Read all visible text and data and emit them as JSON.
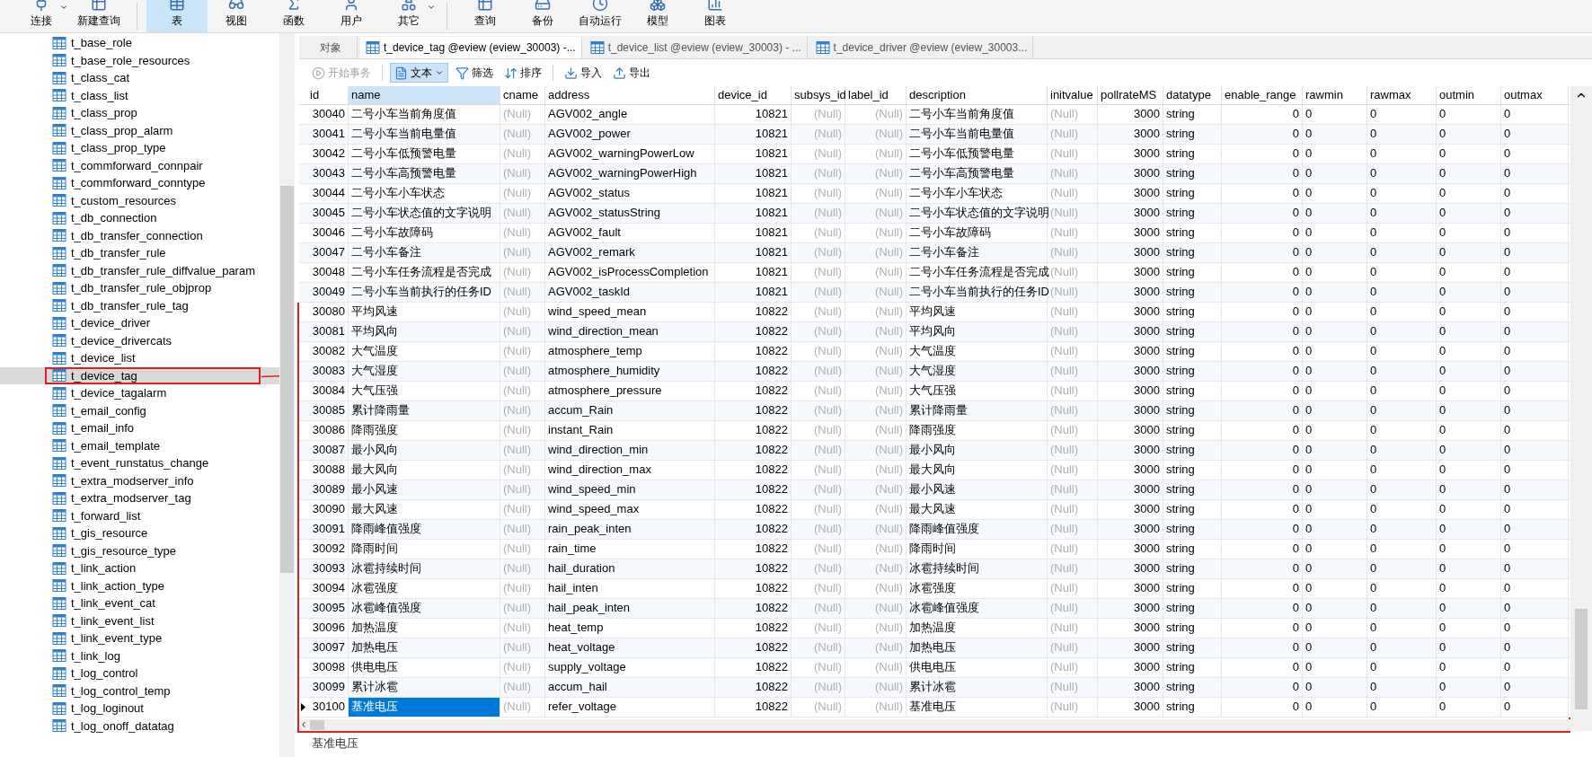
{
  "toolbar": {
    "buttons": [
      {
        "label": "连接",
        "kind": "connect",
        "selected": false,
        "menu": true
      },
      {
        "label": "新建查询",
        "kind": "new_query",
        "selected": false,
        "menu": false
      },
      {
        "label": "表",
        "kind": "table",
        "selected": true,
        "menu": false
      },
      {
        "label": "视图",
        "kind": "view",
        "selected": false,
        "menu": false
      },
      {
        "label": "函数",
        "kind": "function",
        "selected": false,
        "menu": false
      },
      {
        "label": "用户",
        "kind": "user",
        "selected": false,
        "menu": false
      },
      {
        "label": "其它",
        "kind": "other",
        "selected": false,
        "menu": true
      },
      {
        "label": "查询",
        "kind": "query",
        "selected": false,
        "menu": false
      },
      {
        "label": "备份",
        "kind": "backup",
        "selected": false,
        "menu": false
      },
      {
        "label": "自动运行",
        "kind": "schedule",
        "selected": false,
        "menu": false
      },
      {
        "label": "模型",
        "kind": "model",
        "selected": false,
        "menu": false
      },
      {
        "label": "图表",
        "kind": "chart",
        "selected": false,
        "menu": false
      }
    ]
  },
  "sidebar": {
    "items": [
      {
        "label": "t_base_role",
        "selected": false,
        "highlighted": false
      },
      {
        "label": "t_base_role_resources",
        "selected": false,
        "highlighted": false
      },
      {
        "label": "t_class_cat",
        "selected": false,
        "highlighted": false
      },
      {
        "label": "t_class_list",
        "selected": false,
        "highlighted": false
      },
      {
        "label": "t_class_prop",
        "selected": false,
        "highlighted": false
      },
      {
        "label": "t_class_prop_alarm",
        "selected": false,
        "highlighted": false
      },
      {
        "label": "t_class_prop_type",
        "selected": false,
        "highlighted": false
      },
      {
        "label": "t_commforward_connpair",
        "selected": false,
        "highlighted": false
      },
      {
        "label": "t_commforward_conntype",
        "selected": false,
        "highlighted": false
      },
      {
        "label": "t_custom_resources",
        "selected": false,
        "highlighted": false
      },
      {
        "label": "t_db_connection",
        "selected": false,
        "highlighted": false
      },
      {
        "label": "t_db_transfer_connection",
        "selected": false,
        "highlighted": false
      },
      {
        "label": "t_db_transfer_rule",
        "selected": false,
        "highlighted": false
      },
      {
        "label": "t_db_transfer_rule_diffvalue_param",
        "selected": false,
        "highlighted": false
      },
      {
        "label": "t_db_transfer_rule_objprop",
        "selected": false,
        "highlighted": false
      },
      {
        "label": "t_db_transfer_rule_tag",
        "selected": false,
        "highlighted": false
      },
      {
        "label": "t_device_driver",
        "selected": false,
        "highlighted": false
      },
      {
        "label": "t_device_drivercats",
        "selected": false,
        "highlighted": false
      },
      {
        "label": "t_device_list",
        "selected": false,
        "highlighted": false
      },
      {
        "label": "t_device_tag",
        "selected": true,
        "highlighted": true
      },
      {
        "label": "t_device_tagalarm",
        "selected": false,
        "highlighted": false
      },
      {
        "label": "t_email_config",
        "selected": false,
        "highlighted": false
      },
      {
        "label": "t_email_info",
        "selected": false,
        "highlighted": false
      },
      {
        "label": "t_email_template",
        "selected": false,
        "highlighted": false
      },
      {
        "label": "t_event_runstatus_change",
        "selected": false,
        "highlighted": false
      },
      {
        "label": "t_extra_modserver_info",
        "selected": false,
        "highlighted": false
      },
      {
        "label": "t_extra_modserver_tag",
        "selected": false,
        "highlighted": false
      },
      {
        "label": "t_forward_list",
        "selected": false,
        "highlighted": false
      },
      {
        "label": "t_gis_resource",
        "selected": false,
        "highlighted": false
      },
      {
        "label": "t_gis_resource_type",
        "selected": false,
        "highlighted": false
      },
      {
        "label": "t_link_action",
        "selected": false,
        "highlighted": false
      },
      {
        "label": "t_link_action_type",
        "selected": false,
        "highlighted": false
      },
      {
        "label": "t_link_event_cat",
        "selected": false,
        "highlighted": false
      },
      {
        "label": "t_link_event_list",
        "selected": false,
        "highlighted": false
      },
      {
        "label": "t_link_event_type",
        "selected": false,
        "highlighted": false
      },
      {
        "label": "t_link_log",
        "selected": false,
        "highlighted": false
      },
      {
        "label": "t_log_control",
        "selected": false,
        "highlighted": false
      },
      {
        "label": "t_log_control_temp",
        "selected": false,
        "highlighted": false
      },
      {
        "label": "t_log_loginout",
        "selected": false,
        "highlighted": false
      },
      {
        "label": "t_log_onoff_datatag",
        "selected": false,
        "highlighted": false
      }
    ]
  },
  "tabs": [
    {
      "label": "对象",
      "kind": "objects",
      "selected": false
    },
    {
      "label": "t_device_tag @eview (eview_30003) -...",
      "kind": "table",
      "selected": true
    },
    {
      "label": "t_device_list @eview (eview_30003) - ...",
      "kind": "table",
      "selected": false
    },
    {
      "label": "t_device_driver @eview (eview_30003...",
      "kind": "table",
      "selected": false
    }
  ],
  "grid_toolbar": {
    "buttons": [
      {
        "label": "开始事务",
        "kind": "transaction",
        "disabled": true,
        "pressed": false,
        "menu": false
      },
      {
        "label": "文本",
        "kind": "text",
        "disabled": false,
        "pressed": true,
        "menu": true
      },
      {
        "label": "筛选",
        "kind": "filter",
        "disabled": false,
        "pressed": false,
        "menu": false
      },
      {
        "label": "排序",
        "kind": "sort",
        "disabled": false,
        "pressed": false,
        "menu": false
      },
      {
        "label": "导入",
        "kind": "import",
        "disabled": false,
        "pressed": false,
        "menu": false
      },
      {
        "label": "导出",
        "kind": "export",
        "disabled": false,
        "pressed": false,
        "menu": false
      }
    ]
  },
  "table": {
    "columns": [
      {
        "label": "id",
        "kind": "number",
        "empty": false,
        "focused": false
      },
      {
        "label": "name",
        "kind": "text",
        "empty": false,
        "focused": true
      },
      {
        "label": "cname",
        "kind": "text",
        "empty": true,
        "focused": false
      },
      {
        "label": "address",
        "kind": "text",
        "empty": false,
        "focused": false
      },
      {
        "label": "device_id",
        "kind": "number",
        "empty": false,
        "focused": false
      },
      {
        "label": "subsys_id",
        "kind": "number",
        "empty": true,
        "focused": false
      },
      {
        "label": "label_id",
        "kind": "number",
        "empty": true,
        "focused": false
      },
      {
        "label": "description",
        "kind": "text",
        "empty": false,
        "focused": false
      },
      {
        "label": "initvalue",
        "kind": "text",
        "empty": true,
        "focused": false
      },
      {
        "label": "pollrateMS",
        "kind": "number",
        "empty": false,
        "focused": false
      },
      {
        "label": "datatype",
        "kind": "text",
        "empty": false,
        "focused": false
      },
      {
        "label": "enable_range",
        "kind": "number",
        "empty": false,
        "focused": false
      },
      {
        "label": "rawmin",
        "kind": "text",
        "empty": false,
        "focused": false
      },
      {
        "label": "rawmax",
        "kind": "text",
        "empty": false,
        "focused": false
      },
      {
        "label": "outmin",
        "kind": "text",
        "empty": false,
        "focused": false
      },
      {
        "label": "outmax",
        "kind": "text",
        "empty": false,
        "focused": false
      }
    ],
    "row_groups": [
      {
        "annotated": false,
        "rows": [
          {
            "selected": false,
            "cells": [
              "30040",
              "二号小车当前角度值",
              "(Null)",
              "AGV002_angle",
              "10821",
              "(Null)",
              "(Null)",
              "二号小车当前角度值",
              "(Null)",
              "3000",
              "string",
              "0",
              "0",
              "0",
              "0",
              "0"
            ]
          },
          {
            "selected": false,
            "cells": [
              "30041",
              "二号小车当前电量值",
              "(Null)",
              "AGV002_power",
              "10821",
              "(Null)",
              "(Null)",
              "二号小车当前电量值",
              "(Null)",
              "3000",
              "string",
              "0",
              "0",
              "0",
              "0",
              "0"
            ]
          },
          {
            "selected": false,
            "cells": [
              "30042",
              "二号小车低预警电量",
              "(Null)",
              "AGV002_warningPowerLow",
              "10821",
              "(Null)",
              "(Null)",
              "二号小车低预警电量",
              "(Null)",
              "3000",
              "string",
              "0",
              "0",
              "0",
              "0",
              "0"
            ]
          },
          {
            "selected": false,
            "cells": [
              "30043",
              "二号小车高预警电量",
              "(Null)",
              "AGV002_warningPowerHigh",
              "10821",
              "(Null)",
              "(Null)",
              "二号小车高预警电量",
              "(Null)",
              "3000",
              "string",
              "0",
              "0",
              "0",
              "0",
              "0"
            ]
          },
          {
            "selected": false,
            "cells": [
              "30044",
              "二号小车小车状态",
              "(Null)",
              "AGV002_status",
              "10821",
              "(Null)",
              "(Null)",
              "二号小车小车状态",
              "(Null)",
              "3000",
              "string",
              "0",
              "0",
              "0",
              "0",
              "0"
            ]
          },
          {
            "selected": false,
            "cells": [
              "30045",
              "二号小车状态值的文字说明",
              "(Null)",
              "AGV002_statusString",
              "10821",
              "(Null)",
              "(Null)",
              "二号小车状态值的文字说明",
              "(Null)",
              "3000",
              "string",
              "0",
              "0",
              "0",
              "0",
              "0"
            ]
          },
          {
            "selected": false,
            "cells": [
              "30046",
              "二号小车故障码",
              "(Null)",
              "AGV002_fault",
              "10821",
              "(Null)",
              "(Null)",
              "二号小车故障码",
              "(Null)",
              "3000",
              "string",
              "0",
              "0",
              "0",
              "0",
              "0"
            ]
          },
          {
            "selected": false,
            "cells": [
              "30047",
              "二号小车备注",
              "(Null)",
              "AGV002_remark",
              "10821",
              "(Null)",
              "(Null)",
              "二号小车备注",
              "(Null)",
              "3000",
              "string",
              "0",
              "0",
              "0",
              "0",
              "0"
            ]
          },
          {
            "selected": false,
            "cells": [
              "30048",
              "二号小车任务流程是否完成",
              "(Null)",
              "AGV002_isProcessCompletion",
              "10821",
              "(Null)",
              "(Null)",
              "二号小车任务流程是否完成",
              "(Null)",
              "3000",
              "string",
              "0",
              "0",
              "0",
              "0",
              "0"
            ]
          },
          {
            "selected": false,
            "cells": [
              "30049",
              "二号小车当前执行的任务ID",
              "(Null)",
              "AGV002_taskId",
              "10821",
              "(Null)",
              "(Null)",
              "二号小车当前执行的任务ID",
              "(Null)",
              "3000",
              "string",
              "0",
              "0",
              "0",
              "0",
              "0"
            ]
          }
        ]
      },
      {
        "annotated": true,
        "rows": [
          {
            "selected": false,
            "cells": [
              "30080",
              "平均风速",
              "(Null)",
              "wind_speed_mean",
              "10822",
              "(Null)",
              "(Null)",
              "平均风速",
              "(Null)",
              "3000",
              "string",
              "0",
              "0",
              "0",
              "0",
              "0"
            ]
          },
          {
            "selected": false,
            "cells": [
              "30081",
              "平均风向",
              "(Null)",
              "wind_direction_mean",
              "10822",
              "(Null)",
              "(Null)",
              "平均风向",
              "(Null)",
              "3000",
              "string",
              "0",
              "0",
              "0",
              "0",
              "0"
            ]
          },
          {
            "selected": false,
            "cells": [
              "30082",
              "大气温度",
              "(Null)",
              "atmosphere_temp",
              "10822",
              "(Null)",
              "(Null)",
              "大气温度",
              "(Null)",
              "3000",
              "string",
              "0",
              "0",
              "0",
              "0",
              "0"
            ]
          },
          {
            "selected": false,
            "cells": [
              "30083",
              "大气湿度",
              "(Null)",
              "atmosphere_humidity",
              "10822",
              "(Null)",
              "(Null)",
              "大气湿度",
              "(Null)",
              "3000",
              "string",
              "0",
              "0",
              "0",
              "0",
              "0"
            ]
          },
          {
            "selected": false,
            "cells": [
              "30084",
              "大气压强",
              "(Null)",
              "atmosphere_pressure",
              "10822",
              "(Null)",
              "(Null)",
              "大气压强",
              "(Null)",
              "3000",
              "string",
              "0",
              "0",
              "0",
              "0",
              "0"
            ]
          },
          {
            "selected": false,
            "cells": [
              "30085",
              "累计降雨量",
              "(Null)",
              "accum_Rain",
              "10822",
              "(Null)",
              "(Null)",
              "累计降雨量",
              "(Null)",
              "3000",
              "string",
              "0",
              "0",
              "0",
              "0",
              "0"
            ]
          },
          {
            "selected": false,
            "cells": [
              "30086",
              "降雨强度",
              "(Null)",
              "instant_Rain",
              "10822",
              "(Null)",
              "(Null)",
              "降雨强度",
              "(Null)",
              "3000",
              "string",
              "0",
              "0",
              "0",
              "0",
              "0"
            ]
          },
          {
            "selected": false,
            "cells": [
              "30087",
              "最小风向",
              "(Null)",
              "wind_direction_min",
              "10822",
              "(Null)",
              "(Null)",
              "最小风向",
              "(Null)",
              "3000",
              "string",
              "0",
              "0",
              "0",
              "0",
              "0"
            ]
          },
          {
            "selected": false,
            "cells": [
              "30088",
              "最大风向",
              "(Null)",
              "wind_direction_max",
              "10822",
              "(Null)",
              "(Null)",
              "最大风向",
              "(Null)",
              "3000",
              "string",
              "0",
              "0",
              "0",
              "0",
              "0"
            ]
          },
          {
            "selected": false,
            "cells": [
              "30089",
              "最小风速",
              "(Null)",
              "wind_speed_min",
              "10822",
              "(Null)",
              "(Null)",
              "最小风速",
              "(Null)",
              "3000",
              "string",
              "0",
              "0",
              "0",
              "0",
              "0"
            ]
          },
          {
            "selected": false,
            "cells": [
              "30090",
              "最大风速",
              "(Null)",
              "wind_speed_max",
              "10822",
              "(Null)",
              "(Null)",
              "最大风速",
              "(Null)",
              "3000",
              "string",
              "0",
              "0",
              "0",
              "0",
              "0"
            ]
          },
          {
            "selected": false,
            "cells": [
              "30091",
              "降雨峰值强度",
              "(Null)",
              "rain_peak_inten",
              "10822",
              "(Null)",
              "(Null)",
              "降雨峰值强度",
              "(Null)",
              "3000",
              "string",
              "0",
              "0",
              "0",
              "0",
              "0"
            ]
          },
          {
            "selected": false,
            "cells": [
              "30092",
              "降雨时间",
              "(Null)",
              "rain_time",
              "10822",
              "(Null)",
              "(Null)",
              "降雨时间",
              "(Null)",
              "3000",
              "string",
              "0",
              "0",
              "0",
              "0",
              "0"
            ]
          },
          {
            "selected": false,
            "cells": [
              "30093",
              "冰雹持续时间",
              "(Null)",
              "hail_duration",
              "10822",
              "(Null)",
              "(Null)",
              "冰雹持续时间",
              "(Null)",
              "3000",
              "string",
              "0",
              "0",
              "0",
              "0",
              "0"
            ]
          },
          {
            "selected": false,
            "cells": [
              "30094",
              "冰雹强度",
              "(Null)",
              "hail_inten",
              "10822",
              "(Null)",
              "(Null)",
              "冰雹强度",
              "(Null)",
              "3000",
              "string",
              "0",
              "0",
              "0",
              "0",
              "0"
            ]
          },
          {
            "selected": false,
            "cells": [
              "30095",
              "冰雹峰值强度",
              "(Null)",
              "hail_peak_inten",
              "10822",
              "(Null)",
              "(Null)",
              "冰雹峰值强度",
              "(Null)",
              "3000",
              "string",
              "0",
              "0",
              "0",
              "0",
              "0"
            ]
          },
          {
            "selected": false,
            "cells": [
              "30096",
              "加热温度",
              "(Null)",
              "heat_temp",
              "10822",
              "(Null)",
              "(Null)",
              "加热温度",
              "(Null)",
              "3000",
              "string",
              "0",
              "0",
              "0",
              "0",
              "0"
            ]
          },
          {
            "selected": false,
            "cells": [
              "30097",
              "加热电压",
              "(Null)",
              "heat_voltage",
              "10822",
              "(Null)",
              "(Null)",
              "加热电压",
              "(Null)",
              "3000",
              "string",
              "0",
              "0",
              "0",
              "0",
              "0"
            ]
          },
          {
            "selected": false,
            "cells": [
              "30098",
              "供电电压",
              "(Null)",
              "supply_voltage",
              "10822",
              "(Null)",
              "(Null)",
              "供电电压",
              "(Null)",
              "3000",
              "string",
              "0",
              "0",
              "0",
              "0",
              "0"
            ]
          },
          {
            "selected": false,
            "cells": [
              "30099",
              "累计冰雹",
              "(Null)",
              "accum_hail",
              "10822",
              "(Null)",
              "(Null)",
              "累计冰雹",
              "(Null)",
              "3000",
              "string",
              "0",
              "0",
              "0",
              "0",
              "0"
            ]
          },
          {
            "selected": true,
            "cells": [
              "30100",
              "基准电压",
              "(Null)",
              "refer_voltage",
              "10822",
              "(Null)",
              "(Null)",
              "基准电压",
              "(Null)",
              "3000",
              "string",
              "0",
              "0",
              "0",
              "0",
              "0"
            ]
          }
        ]
      }
    ]
  },
  "status_bar": {
    "text": "基准电压"
  }
}
